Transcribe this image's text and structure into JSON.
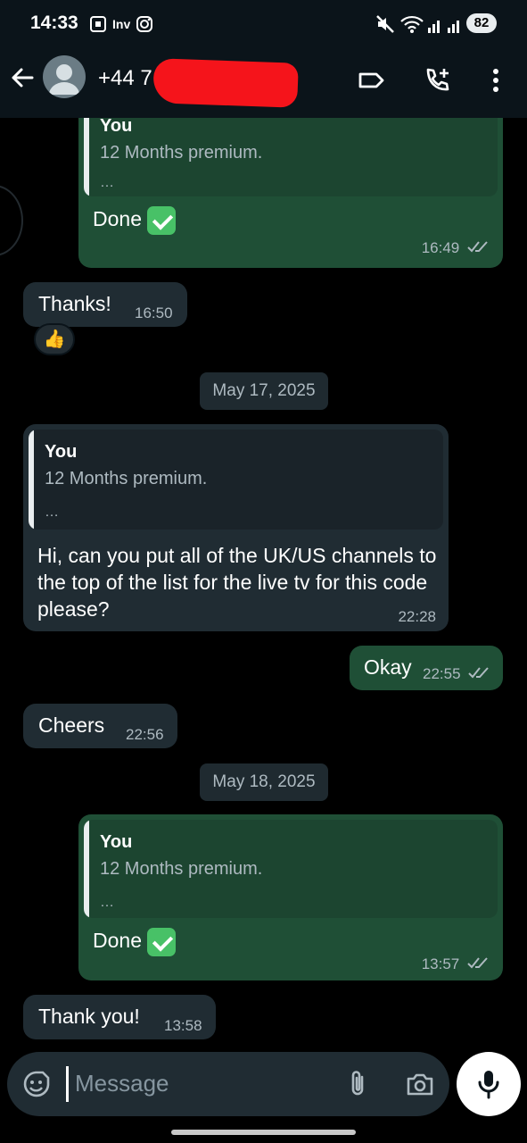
{
  "status_bar": {
    "time": "14:33",
    "notif_label": "Inv",
    "battery": "82"
  },
  "header": {
    "contact_visible": "+44 7"
  },
  "messages": [
    {
      "quote_author": "You",
      "quote_text": "12 Months premium.",
      "quote_more": "…",
      "text": "Done",
      "time": "16:49"
    },
    {
      "text": "Thanks!",
      "time": "16:50",
      "reaction": "👍"
    },
    {
      "date": "May 17, 2025"
    },
    {
      "quote_author": "You",
      "quote_text": "12 Months premium.",
      "quote_more": "…",
      "text": "Hi, can you put all of the UK/US channels to the top of the list for the live tv for this code please?",
      "time": "22:28"
    },
    {
      "text": "Okay",
      "time": "22:55"
    },
    {
      "text": "Cheers",
      "time": "22:56"
    },
    {
      "date": "May 18, 2025"
    },
    {
      "quote_author": "You",
      "quote_text": "12 Months premium.",
      "quote_more": "…",
      "text": "Done",
      "time": "13:57"
    },
    {
      "text": "Thank you!",
      "time": "13:58"
    }
  ],
  "composer": {
    "placeholder": "Message"
  },
  "colors": {
    "outgoing_bubble": "#1f4f36",
    "incoming_bubble": "#202c33",
    "check_emoji": "#48c167"
  },
  "icons": [
    "back-arrow-icon",
    "label-icon",
    "add-call-icon",
    "more-vert-icon",
    "sticker-icon",
    "attach-icon",
    "camera-icon",
    "mic-icon",
    "read-ticks-icon"
  ]
}
